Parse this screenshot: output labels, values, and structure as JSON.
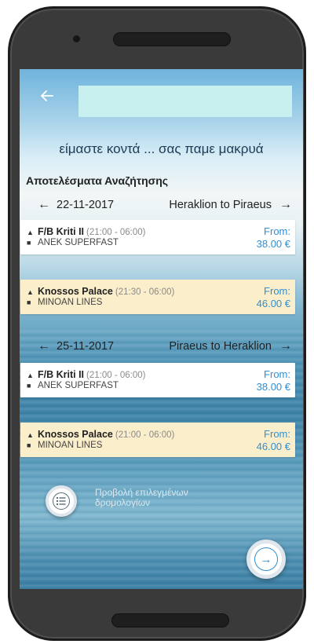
{
  "header": {
    "back_icon": "arrow-left-icon",
    "title_box_color": "#c8f0ef"
  },
  "slogan": "είμαστε κοντά ... σας παμε μακρυά",
  "results_title": "Αποτελέσματα Αναζήτησης",
  "legs": [
    {
      "date": "22-11-2017",
      "route": "Heraklion to Piraeus",
      "results": [
        {
          "ship": "F/B Kriti II",
          "time": "(21:00 - 06:00)",
          "company": "ANEK SUPERFAST",
          "from_label": "From:",
          "price": "38.00 €",
          "highlighted": false
        },
        {
          "ship": "Knossos Palace",
          "time": "(21:30 - 06:00)",
          "company": "MINOAN LINES",
          "from_label": "From:",
          "price": "46.00 €",
          "highlighted": true
        }
      ]
    },
    {
      "date": "25-11-2017",
      "route": "Piraeus to Heraklion",
      "results": [
        {
          "ship": "F/B Kriti II",
          "time": "(21:00 - 06:00)",
          "company": "ANEK SUPERFAST",
          "from_label": "From:",
          "price": "38.00 €",
          "highlighted": false
        },
        {
          "ship": "Knossos Palace",
          "time": "(21:00 - 06:00)",
          "company": "MINOAN LINES",
          "from_label": "From:",
          "price": "46.00 €",
          "highlighted": true
        }
      ]
    }
  ],
  "footer": {
    "list_button_icon": "list-icon",
    "list_button_label": "Προβολή επιλεγμένων δρομολογίων",
    "next_button_icon": "arrow-right-icon"
  },
  "colors": {
    "accent": "#2f8fd4",
    "highlight_card": "#fbeecb"
  }
}
